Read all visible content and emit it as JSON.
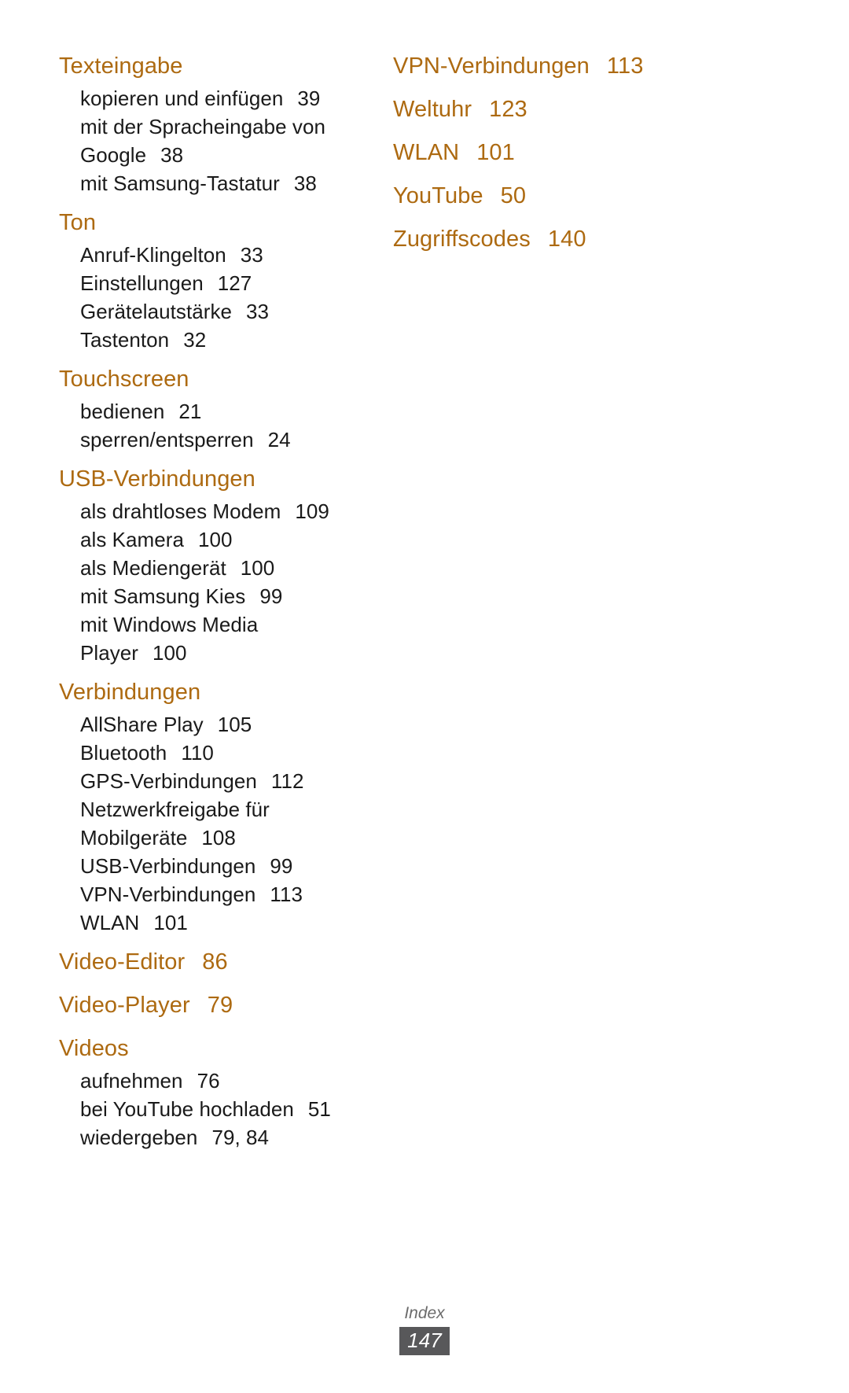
{
  "document": {
    "type": "index",
    "heading_color": "#AD6A11",
    "body_color": "#1a1a1a",
    "footer_badge_color": "#58585A"
  },
  "left_column": {
    "groups": [
      {
        "title": "Texteingabe",
        "page": "",
        "entries": [
          {
            "label": "kopieren und einfügen",
            "page": "39"
          },
          {
            "label": "mit der Spracheingabe von",
            "page": ""
          },
          {
            "label": "Google",
            "page": "38"
          },
          {
            "label": "mit Samsung-Tastatur",
            "page": "38"
          }
        ]
      },
      {
        "title": "Ton",
        "page": "",
        "entries": [
          {
            "label": "Anruf-Klingelton",
            "page": "33"
          },
          {
            "label": "Einstellungen",
            "page": "127"
          },
          {
            "label": "Gerätelautstärke",
            "page": "33"
          },
          {
            "label": "Tastenton",
            "page": "32"
          }
        ]
      },
      {
        "title": "Touchscreen",
        "page": "",
        "entries": [
          {
            "label": "bedienen",
            "page": "21"
          },
          {
            "label": "sperren/entsperren",
            "page": "24"
          }
        ]
      },
      {
        "title": "USB-Verbindungen",
        "page": "",
        "entries": [
          {
            "label": "als drahtloses Modem",
            "page": "109"
          },
          {
            "label": "als Kamera",
            "page": "100"
          },
          {
            "label": "als Mediengerät",
            "page": "100"
          },
          {
            "label": "mit Samsung Kies",
            "page": "99"
          },
          {
            "label": "mit Windows Media",
            "page": ""
          },
          {
            "label": "Player",
            "page": "100"
          }
        ]
      },
      {
        "title": "Verbindungen",
        "page": "",
        "entries": [
          {
            "label": "AllShare Play",
            "page": "105"
          },
          {
            "label": "Bluetooth",
            "page": "110"
          },
          {
            "label": "GPS-Verbindungen",
            "page": "112"
          },
          {
            "label": "Netzwerkfreigabe für",
            "page": ""
          },
          {
            "label": "Mobilgeräte",
            "page": "108"
          },
          {
            "label": "USB-Verbindungen",
            "page": "99"
          },
          {
            "label": "VPN-Verbindungen",
            "page": "113"
          },
          {
            "label": "WLAN",
            "page": "101"
          }
        ]
      },
      {
        "title": "Video-Editor",
        "page": "86",
        "entries": []
      },
      {
        "title": "Video-Player",
        "page": "79",
        "entries": []
      },
      {
        "title": "Videos",
        "page": "",
        "entries": [
          {
            "label": "aufnehmen",
            "page": "76"
          },
          {
            "label": "bei YouTube hochladen",
            "page": "51"
          },
          {
            "label": "wiedergeben",
            "page": "79, 84"
          }
        ]
      }
    ]
  },
  "right_column": {
    "groups": [
      {
        "title": "VPN-Verbindungen",
        "page": "113",
        "entries": []
      },
      {
        "title": "Weltuhr",
        "page": "123",
        "entries": []
      },
      {
        "title": "WLAN",
        "page": "101",
        "entries": []
      },
      {
        "title": "YouTube",
        "page": "50",
        "entries": []
      },
      {
        "title": "Zugriffscodes",
        "page": "140",
        "entries": []
      }
    ]
  },
  "footer": {
    "label": "Index",
    "page_number": "147"
  }
}
